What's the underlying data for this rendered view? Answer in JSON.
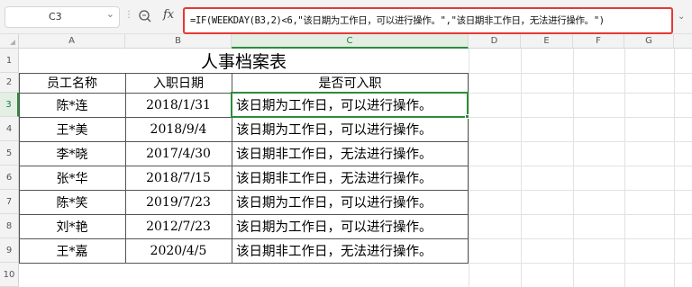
{
  "formula_bar": {
    "name_box": "C3",
    "fx_label": "fx",
    "formula": "=IF(WEEKDAY(B3,2)<6,\"该日期为工作日，可以进行操作。\",\"该日期非工作日，无法进行操作。\")"
  },
  "columns": [
    "A",
    "B",
    "C",
    "D",
    "E",
    "F",
    "G"
  ],
  "rows": [
    "1",
    "2",
    "3",
    "4",
    "5",
    "6",
    "7",
    "8",
    "9",
    "10"
  ],
  "selected_cell": "C3",
  "sheet": {
    "title": "人事档案表",
    "headers": [
      "员工名称",
      "入职日期",
      "是否可入职"
    ],
    "records": [
      {
        "name": "陈*连",
        "date": "2018/1/31",
        "status": "该日期为工作日，可以进行操作。"
      },
      {
        "name": "王*美",
        "date": "2018/9/4",
        "status": "该日期为工作日，可以进行操作。"
      },
      {
        "name": "李*晓",
        "date": "2017/4/30",
        "status": "该日期非工作日，无法进行操作。"
      },
      {
        "name": "张*华",
        "date": "2018/7/15",
        "status": "该日期非工作日，无法进行操作。"
      },
      {
        "name": "陈*笑",
        "date": "2019/7/23",
        "status": "该日期为工作日，可以进行操作。"
      },
      {
        "name": "刘*艳",
        "date": "2012/7/23",
        "status": "该日期为工作日，可以进行操作。"
      },
      {
        "name": "王*嘉",
        "date": "2020/4/5",
        "status": "该日期非工作日，无法进行操作。"
      }
    ]
  },
  "colors": {
    "selection": "#2e8b3e",
    "formula_highlight": "#e53935"
  }
}
